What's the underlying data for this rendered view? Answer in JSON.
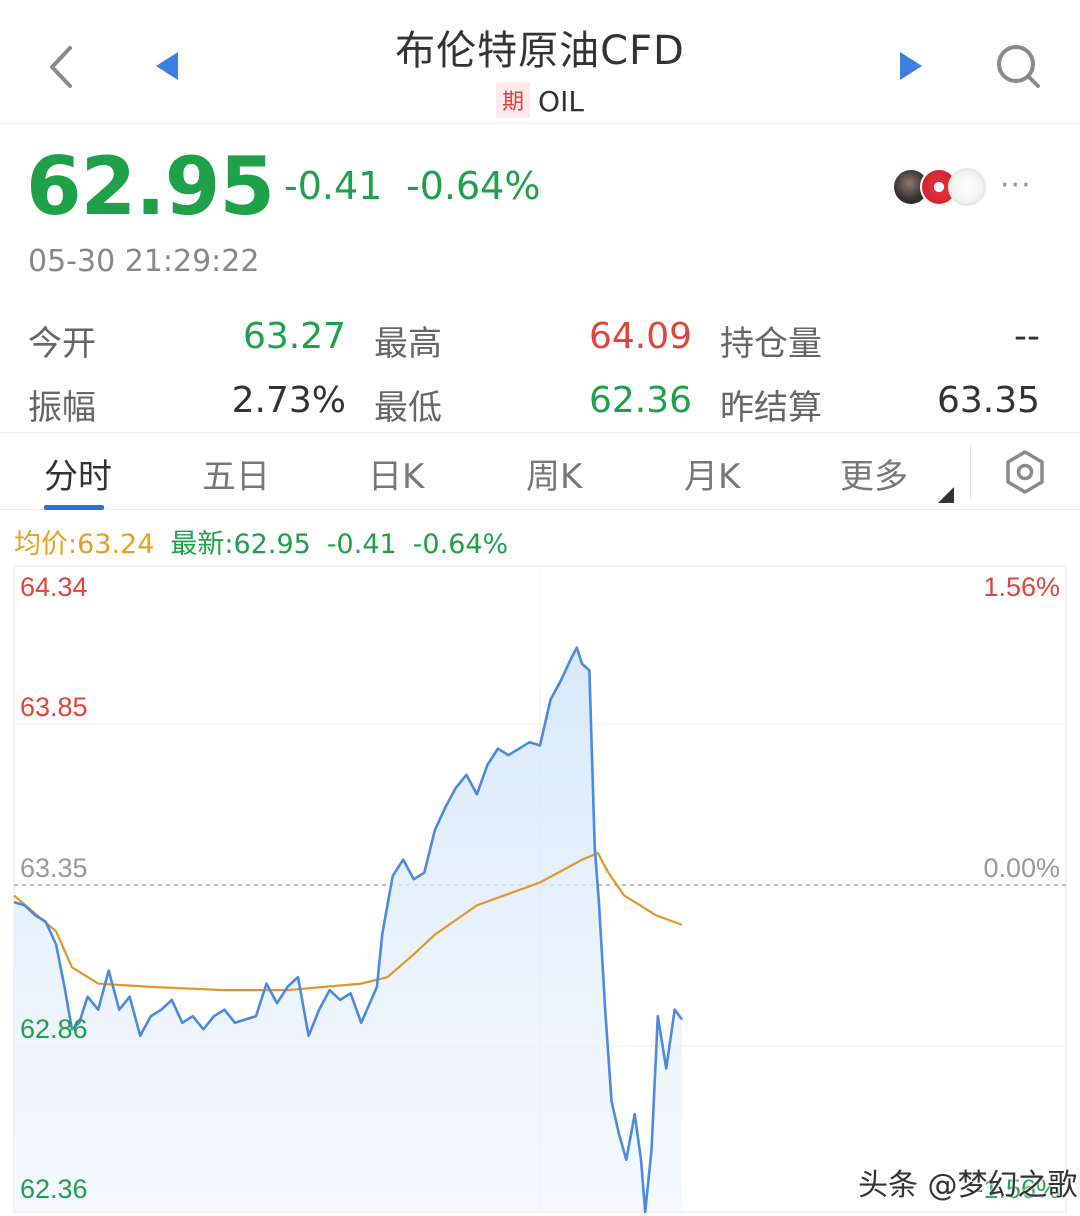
{
  "header": {
    "title": "布伦特原油CFD",
    "badge": "期",
    "symbol": "OIL",
    "icons": [
      "back-icon",
      "prev-triangle-icon",
      "next-triangle-icon",
      "search-icon"
    ]
  },
  "quote": {
    "price": "62.95",
    "change": "-0.41",
    "change_pct": "-0.64%",
    "timestamp": "05-30 21:29:22",
    "more": "···"
  },
  "stats": {
    "open_label": "今开",
    "open": "63.27",
    "high_label": "最高",
    "high": "64.09",
    "oi_label": "持仓量",
    "oi": "--",
    "amp_label": "振幅",
    "amp": "2.73%",
    "low_label": "最低",
    "low": "62.36",
    "prev_label": "昨结算",
    "prev": "63.35"
  },
  "tabs": [
    "分时",
    "五日",
    "日K",
    "周K",
    "月K",
    "更多"
  ],
  "active_tab": "分时",
  "legend": {
    "avg": "均价:63.24",
    "last": "最新:62.95",
    "chg": "-0.41",
    "pct": "-0.64%"
  },
  "colors": {
    "up": "#e0453b",
    "down": "#1fa14a",
    "price_line": "#4a8ae0",
    "avg_line": "#e3962a",
    "accent": "#2c6fd9"
  },
  "watermark": "头条 @梦幻之歌",
  "chart_data": {
    "type": "line",
    "ylim": [
      62.36,
      64.34
    ],
    "y_ticks_left": [
      "64.34",
      "63.85",
      "63.35",
      "62.86",
      "62.36"
    ],
    "y_ticks_right": [
      "1.56%",
      "0.00%",
      "-1.56%"
    ],
    "reference": 63.35,
    "x_range": [
      0,
      1
    ],
    "series": [
      {
        "values": [
          [
            0.0,
            63.31
          ],
          [
            0.01,
            63.3
          ],
          [
            0.02,
            63.27
          ],
          [
            0.03,
            63.25
          ],
          [
            0.04,
            63.18
          ],
          [
            0.048,
            63.05
          ],
          [
            0.055,
            62.92
          ],
          [
            0.062,
            62.94
          ],
          [
            0.07,
            63.02
          ],
          [
            0.08,
            62.98
          ],
          [
            0.09,
            63.1
          ],
          [
            0.1,
            62.98
          ],
          [
            0.11,
            63.02
          ],
          [
            0.12,
            62.9
          ],
          [
            0.13,
            62.96
          ],
          [
            0.14,
            62.98
          ],
          [
            0.15,
            63.01
          ],
          [
            0.16,
            62.94
          ],
          [
            0.17,
            62.96
          ],
          [
            0.18,
            62.92
          ],
          [
            0.19,
            62.96
          ],
          [
            0.2,
            62.98
          ],
          [
            0.21,
            62.94
          ],
          [
            0.22,
            62.95
          ],
          [
            0.23,
            62.96
          ],
          [
            0.24,
            63.06
          ],
          [
            0.25,
            63.0
          ],
          [
            0.26,
            63.05
          ],
          [
            0.27,
            63.08
          ],
          [
            0.28,
            62.9
          ],
          [
            0.29,
            62.98
          ],
          [
            0.3,
            63.04
          ],
          [
            0.31,
            63.01
          ],
          [
            0.32,
            63.03
          ],
          [
            0.33,
            62.94
          ],
          [
            0.345,
            63.05
          ],
          [
            0.35,
            63.21
          ],
          [
            0.36,
            63.39
          ],
          [
            0.37,
            63.44
          ],
          [
            0.38,
            63.38
          ],
          [
            0.39,
            63.4
          ],
          [
            0.4,
            63.53
          ],
          [
            0.41,
            63.6
          ],
          [
            0.42,
            63.66
          ],
          [
            0.43,
            63.7
          ],
          [
            0.44,
            63.64
          ],
          [
            0.45,
            63.73
          ],
          [
            0.46,
            63.78
          ],
          [
            0.47,
            63.76
          ],
          [
            0.48,
            63.78
          ],
          [
            0.49,
            63.8
          ],
          [
            0.5,
            63.79
          ],
          [
            0.51,
            63.93
          ],
          [
            0.52,
            63.99
          ],
          [
            0.53,
            64.06
          ],
          [
            0.535,
            64.09
          ],
          [
            0.54,
            64.04
          ],
          [
            0.547,
            64.02
          ],
          [
            0.552,
            63.48
          ],
          [
            0.556,
            63.31
          ],
          [
            0.562,
            62.98
          ],
          [
            0.568,
            62.7
          ],
          [
            0.575,
            62.6
          ],
          [
            0.582,
            62.52
          ],
          [
            0.59,
            62.66
          ],
          [
            0.596,
            62.52
          ],
          [
            0.6,
            62.36
          ],
          [
            0.606,
            62.55
          ],
          [
            0.612,
            62.96
          ],
          [
            0.62,
            62.8
          ],
          [
            0.628,
            62.98
          ],
          [
            0.635,
            62.95
          ]
        ]
      },
      {
        "values": [
          [
            0.0,
            63.33
          ],
          [
            0.04,
            63.22
          ],
          [
            0.055,
            63.11
          ],
          [
            0.08,
            63.06
          ],
          [
            0.13,
            63.05
          ],
          [
            0.2,
            63.04
          ],
          [
            0.26,
            63.04
          ],
          [
            0.33,
            63.06
          ],
          [
            0.355,
            63.08
          ],
          [
            0.38,
            63.15
          ],
          [
            0.4,
            63.21
          ],
          [
            0.44,
            63.3
          ],
          [
            0.5,
            63.37
          ],
          [
            0.54,
            63.44
          ],
          [
            0.555,
            63.46
          ],
          [
            0.565,
            63.4
          ],
          [
            0.58,
            63.33
          ],
          [
            0.61,
            63.27
          ],
          [
            0.635,
            63.24
          ]
        ]
      }
    ]
  }
}
